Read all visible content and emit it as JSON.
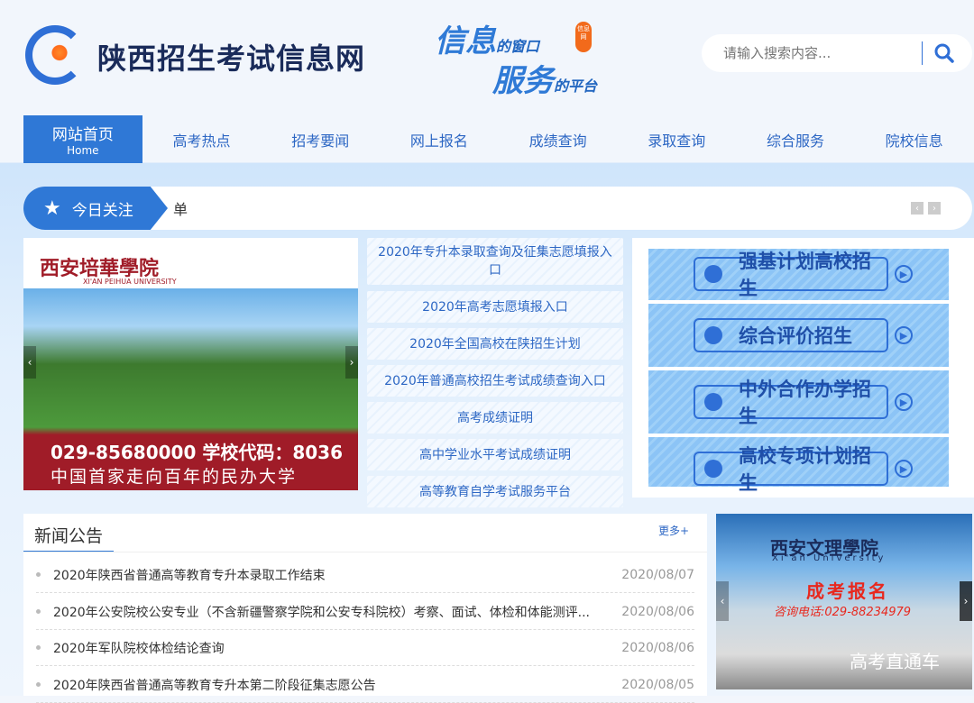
{
  "header": {
    "site_title": "陕西招生考试信息网",
    "slogan_line1_big": "信息",
    "slogan_line1_small": "的窗口",
    "slogan_line2_big": "服务",
    "slogan_line2_small": "的平台",
    "slogan_badge": "信息网",
    "search_placeholder": "请输入搜索内容..."
  },
  "nav": [
    {
      "label": "网站首页",
      "sub": "Home"
    },
    {
      "label": "高考热点"
    },
    {
      "label": "招考要闻"
    },
    {
      "label": "网上报名"
    },
    {
      "label": "成绩查询"
    },
    {
      "label": "录取查询"
    },
    {
      "label": "综合服务"
    },
    {
      "label": "院校信息"
    }
  ],
  "focus": {
    "label": "今日关注",
    "text": "单"
  },
  "banner_left": {
    "university": "西安培華學院",
    "university_en": "XI'AN PEIHUA UNIVERSITY",
    "phone": "029-85680000  学校代码：8036",
    "motto": "中国首家走向百年的民办大学"
  },
  "quick_links": [
    "2020年专升本录取查询及征集志愿填报入口",
    "2020年高考志愿填报入口",
    "2020年全国高校在陕招生计划",
    "2020年普通高校招生考试成绩查询入口",
    "高考成绩证明",
    "高中学业水平考试成绩证明",
    "高等教育自学考试服务平台"
  ],
  "enroll_buttons": [
    "强基计划高校招生",
    "综合评价招生",
    "中外合作办学招生",
    "高校专项计划招生"
  ],
  "news": {
    "title": "新闻公告",
    "more": "更多+",
    "items": [
      {
        "title": "2020年陕西省普通高等教育专升本录取工作结束",
        "date": "2020/08/07"
      },
      {
        "title": "2020年公安院校公安专业（不含新疆警察学院和公安专科院校）考察、面试、体检和体能测评...",
        "date": "2020/08/06"
      },
      {
        "title": "2020年军队院校体检结论查询",
        "date": "2020/08/06"
      },
      {
        "title": "2020年陕西省普通高等教育专升本第二阶段征集志愿公告",
        "date": "2020/08/05"
      }
    ]
  },
  "banner_right": {
    "university": "西安文理學院",
    "university_en": "Xi'an University",
    "headline": "成考报名",
    "phone": "咨询电话:029-88234979",
    "caption": "高考直通车"
  }
}
